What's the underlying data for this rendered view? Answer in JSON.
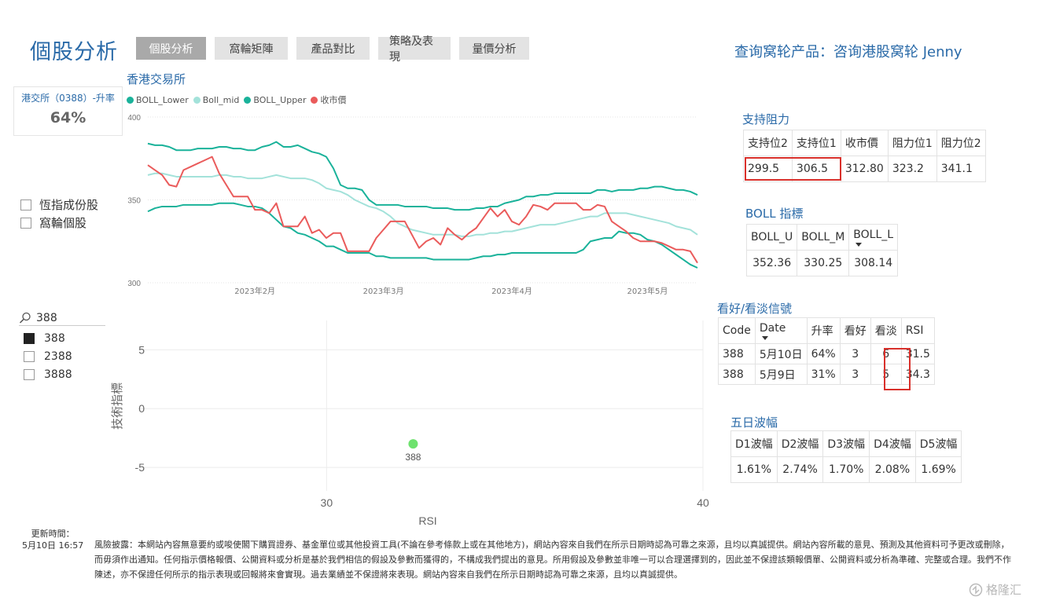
{
  "header": {
    "title": "個股分析",
    "tabs": [
      {
        "label": "個股分析",
        "active": true
      },
      {
        "label": "窩輪矩陣"
      },
      {
        "label": "產品對比"
      },
      {
        "label": "策略及表現"
      },
      {
        "label": "量價分析"
      }
    ],
    "inquiry": "查询窝轮产品：咨询港股窝轮 Jenny"
  },
  "card": {
    "label": "港交所（0388）-升率",
    "value": "64%"
  },
  "filters": [
    {
      "label": "恆指成份股",
      "checked": false
    },
    {
      "label": "窩輪個股",
      "checked": false
    }
  ],
  "slicer": {
    "search": "388",
    "items": [
      {
        "label": "388",
        "checked": true
      },
      {
        "label": "2388",
        "checked": false
      },
      {
        "label": "3888",
        "checked": false
      }
    ]
  },
  "colors": {
    "boll_lower": "#1ab29a",
    "boll_mid": "#a3e2da",
    "boll_upper": "#1ab29a",
    "close": "#ea5b5b",
    "accent": "#2a6aa8",
    "highlight": "#d9302b",
    "scatter_point": "#6ee26e"
  },
  "boll_chart": {
    "title": "香港交易所",
    "legend": [
      "BOLL_Lower",
      "Boll_mid",
      "BOLL_Upper",
      "收市價"
    ],
    "y_ticks": [
      "400",
      "350",
      "300"
    ],
    "x_ticks": [
      "2023年2月",
      "2023年3月",
      "2023年4月",
      "2023年5月"
    ]
  },
  "chart_data": [
    {
      "type": "line",
      "title": "香港交易所",
      "ylim": [
        300,
        400
      ],
      "xlim": [
        0,
        77
      ],
      "x_tick_positions": [
        15,
        33,
        51,
        70
      ],
      "series": [
        {
          "name": "BOLL_Upper",
          "values": [
            384,
            383,
            383,
            382,
            380,
            380,
            380,
            381,
            381,
            381,
            382,
            382,
            381,
            381,
            380,
            380,
            382,
            383,
            385,
            382,
            382,
            383,
            381,
            379,
            378,
            376,
            369,
            359,
            357,
            357,
            356,
            350,
            347,
            347,
            347,
            347,
            346,
            346,
            346,
            346,
            345,
            345,
            345,
            344,
            344,
            344,
            345,
            345,
            346,
            346,
            348,
            349,
            350,
            352,
            352,
            353,
            353,
            354,
            354,
            354,
            354,
            354,
            354,
            356,
            356,
            355,
            356,
            356,
            356,
            357,
            357,
            358,
            358,
            357,
            356,
            356,
            355,
            353
          ]
        },
        {
          "name": "Boll_mid",
          "values": [
            365,
            366,
            366,
            365,
            364,
            364,
            364,
            364,
            364,
            364,
            365,
            365,
            364,
            364,
            363,
            363,
            363,
            364,
            365,
            364,
            363,
            363,
            363,
            362,
            360,
            357,
            356,
            355,
            353,
            350,
            348,
            346,
            345,
            343,
            340,
            336,
            334,
            332,
            331,
            330,
            329,
            329,
            329,
            329,
            328,
            328,
            329,
            329,
            330,
            330,
            331,
            331,
            332,
            333,
            334,
            335,
            335,
            335,
            336,
            337,
            338,
            339,
            340,
            340,
            342,
            342,
            342,
            342,
            341,
            340,
            339,
            338,
            337,
            336,
            334,
            333,
            332,
            329
          ]
        },
        {
          "name": "BOLL_Lower",
          "values": [
            343,
            345,
            346,
            346,
            346,
            347,
            347,
            347,
            347,
            347,
            348,
            348,
            348,
            347,
            346,
            346,
            345,
            342,
            338,
            334,
            333,
            330,
            329,
            327,
            325,
            322,
            322,
            320,
            318,
            318,
            318,
            318,
            316,
            316,
            315,
            315,
            315,
            315,
            315,
            315,
            314,
            314,
            314,
            314,
            314,
            314,
            315,
            316,
            316,
            317,
            317,
            318,
            318,
            318,
            318,
            318,
            318,
            318,
            318,
            318,
            318,
            320,
            325,
            326,
            327,
            327,
            331,
            330,
            330,
            329,
            326,
            325,
            323,
            320,
            317,
            314,
            311,
            309
          ]
        },
        {
          "name": "收市價",
          "values": [
            371,
            368,
            365,
            359,
            358,
            368,
            370,
            372,
            374,
            376,
            366,
            359,
            352,
            352,
            352,
            344,
            344,
            342,
            348,
            334,
            334,
            334,
            340,
            330,
            332,
            327,
            330,
            330,
            319,
            319,
            319,
            319,
            327,
            332,
            337,
            337,
            337,
            329,
            321,
            325,
            327,
            323,
            333,
            329,
            326,
            330,
            333,
            339,
            345,
            340,
            344,
            337,
            335,
            340,
            347,
            346,
            344,
            348,
            348,
            348,
            348,
            344,
            344,
            347,
            346,
            337,
            334,
            331,
            327,
            325,
            325,
            325,
            324,
            322,
            320,
            320,
            319,
            312
          ]
        }
      ]
    },
    {
      "type": "scatter",
      "xlabel": "RSI",
      "ylabel": "技術指標",
      "xlim": [
        25,
        40
      ],
      "ylim": [
        -7,
        7.5
      ],
      "x_ticks": [
        30,
        40
      ],
      "y_ticks": [
        5,
        0,
        -5
      ],
      "points": [
        {
          "label": "388",
          "x": 32.3,
          "y": -3
        }
      ]
    }
  ],
  "support_resistance": {
    "title": "支持阻力",
    "headers": [
      "支持位2",
      "支持位1",
      "收市價",
      "阻力位1",
      "阻力位2"
    ],
    "values": [
      "299.5",
      "306.5",
      "312.80",
      "323.2",
      "341.1"
    ]
  },
  "boll_index": {
    "title": "BOLL 指標",
    "headers": [
      "BOLL_U",
      "BOLL_M",
      "BOLL_L"
    ],
    "values": [
      "352.36",
      "330.25",
      "308.14"
    ]
  },
  "signals": {
    "title": "看好/看淡信號",
    "headers": [
      "Code",
      "Date",
      "升率",
      "看好",
      "看淡",
      "RSI"
    ],
    "rows": [
      [
        "388",
        "5月10日",
        "64%",
        "3",
        "6",
        "31.5"
      ],
      [
        "388",
        "5月9日",
        "31%",
        "3",
        "5",
        "34.3"
      ]
    ]
  },
  "volatility": {
    "title": "五日波幅",
    "headers": [
      "D1波幅",
      "D2波幅",
      "D3波幅",
      "D4波幅",
      "D5波幅"
    ],
    "values": [
      "1.61%",
      "2.74%",
      "1.70%",
      "2.08%",
      "1.69%"
    ]
  },
  "footer": {
    "updated_label": "更新時間：",
    "updated_value": "5月10日 16:57",
    "disclaimer": "風險披露：本網站內容無意要約或唆使閣下購買證券、基金單位或其他投資工具(不論在參考條款上或在其他地方)，網站內容來自我們在所示日期時認為可靠之來源，且均以真誠提供。網站內容所載的意見、預測及其他資料可予更改或刪除，而毋須作出通知。任何指示價格報價、公開資料或分析是基於我們相信的假設及參數而獲得的，不構成我們提出的意見。所用假設及參數並非唯一可以合理選擇到的，因此並不保證該類報價單、公開資料或分析為準確、完整或合理。我們不作陳述，亦不保證任何所示的指示表現或回報將來會實現。過去業績並不保證將來表現。網站內容來自我們在所示日期時認為可靠之來源，且均以真誠提供。",
    "watermark": "格隆汇"
  }
}
